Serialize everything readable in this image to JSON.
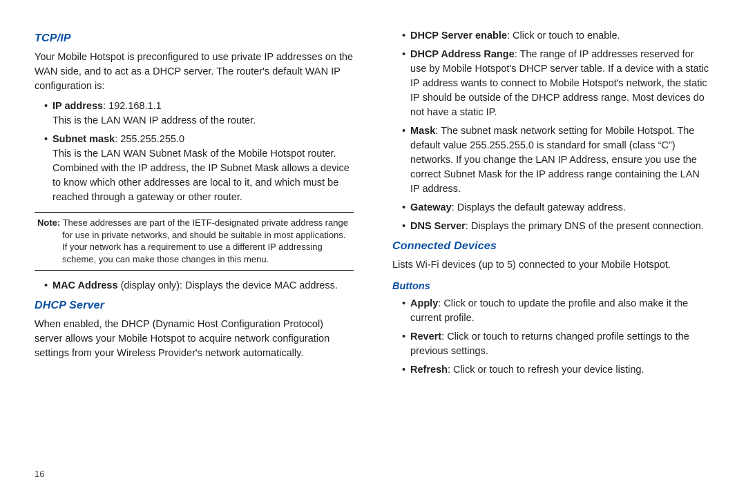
{
  "pageNumber": "16",
  "left": {
    "tcpip": {
      "heading": "TCP/IP",
      "intro": "Your Mobile Hotspot is preconfigured to use private IP addresses on the WAN side, and to act as a DHCP server. The router's default  WAN IP configuration is:",
      "items": [
        {
          "term": "IP address",
          "value": ": 192.168.1.1",
          "desc": "This is the LAN WAN IP address of the router."
        },
        {
          "term": "Subnet mask",
          "value": ": 255.255.255.0",
          "desc": "This is the LAN WAN Subnet Mask of the Mobile Hotspot router. Combined with the IP address, the IP Subnet Mask allows a device to know which other addresses are local to it, and which must be reached through a gateway or other router."
        }
      ],
      "note": {
        "label": "Note:",
        "lead": " These addresses are part of the IETF-designated private address range",
        "body": "for use in private networks, and should be suitable in most applications. If your network has a requirement to use a different IP addressing scheme, you can make those changes in this menu."
      },
      "mac": {
        "term": "MAC Address",
        "value": " (display only): Displays the device MAC address."
      }
    },
    "dhcp": {
      "heading": "DHCP Server",
      "intro": "When enabled, the DHCP (Dynamic Host Configuration Protocol) server allows your Mobile Hotspot to acquire network configuration settings from your Wireless Provider's network automatically."
    }
  },
  "right": {
    "dhcpItems": [
      {
        "term": "DHCP Server enable",
        "value": ": Click or touch to enable."
      },
      {
        "term": "DHCP Address Range",
        "value": ": The range of IP addresses reserved for use by Mobile Hotspot's DHCP server table. If a device with a static IP address wants to connect to Mobile Hotspot's network, the static IP should be outside of the DHCP address range. Most devices do not have a static IP."
      },
      {
        "term": "Mask",
        "value": ": The subnet mask network setting for Mobile Hotspot. The default value 255.255.255.0 is standard for small (class “C”) networks. If you change the LAN IP Address, ensure you use the correct Subnet Mask for the IP address range containing the LAN IP address."
      },
      {
        "term": "Gateway",
        "value": ": Displays the default gateway address."
      },
      {
        "term": "DNS Server",
        "value": ": Displays the primary DNS of the present connection."
      }
    ],
    "connected": {
      "heading": "Connected Devices",
      "intro": "Lists Wi-Fi devices (up to 5) connected to your Mobile Hotspot."
    },
    "buttons": {
      "heading": "Buttons",
      "items": [
        {
          "term": "Apply",
          "value": ": Click or touch to update the profile and also make it the current profile."
        },
        {
          "term": "Revert",
          "value": ": Click or touch to returns changed profile settings to the previous settings."
        },
        {
          "term": "Refresh",
          "value": ": Click or touch to refresh your device listing."
        }
      ]
    }
  }
}
